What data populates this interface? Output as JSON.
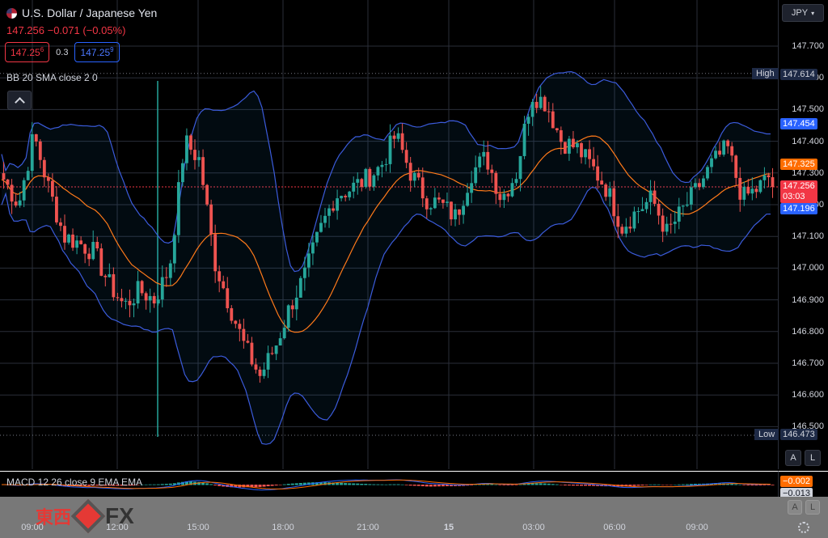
{
  "header": {
    "symbol_title": "U.S. Dollar / Japanese Yen",
    "price_line": "147.256 −0.071 (−0.05%)",
    "bid_main": "147.25",
    "bid_sup": "6",
    "spread": "0.3",
    "ask_main": "147.25",
    "ask_sup": "9",
    "indicator_label": "BB 20 SMA close 2 0",
    "collapse_icon": "chevron-up-icon"
  },
  "axis": {
    "currency": "JPY",
    "ticks": [
      "147.700",
      "147.600",
      "147.500",
      "147.400",
      "147.300",
      "147.200",
      "147.100",
      "147.000",
      "146.900",
      "146.800",
      "146.700",
      "146.600",
      "146.500"
    ],
    "high_label": "High",
    "high_value": "147.614",
    "low_label": "Low",
    "low_value": "146.473",
    "upper_band": "147.454",
    "basis": "147.325",
    "last_price": "147.256",
    "countdown": "03:03",
    "lower_band": "147.196",
    "scale_auto": "A",
    "scale_log": "L"
  },
  "macd": {
    "label": "MACD 12 26 close 9 EMA EMA",
    "value1": "−0.002",
    "value2": "−0.013",
    "scale_auto": "A",
    "scale_log": "L"
  },
  "time_axis": {
    "labels": [
      "09:00",
      "12:00",
      "15:00",
      "18:00",
      "21:00",
      "15",
      "03:00",
      "06:00",
      "09:00"
    ]
  },
  "watermark": {
    "cn": "東西",
    "fx": "FX"
  },
  "colors": {
    "up": "#26a69a",
    "down": "#ef5350",
    "band": "#3b5bdb",
    "basis": "#ff7a1a",
    "last": "#f23645"
  },
  "chart_data": {
    "type": "candlestick",
    "title": "U.S. Dollar / Japanese Yen",
    "ylim": [
      146.45,
      147.76
    ],
    "session_high": 147.614,
    "session_low": 146.473,
    "last": 147.256,
    "bollinger": {
      "period": 20,
      "upper_last": 147.454,
      "basis_last": 147.325,
      "lower_last": 147.196
    },
    "close_path": [
      147.28,
      147.2,
      147.42,
      147.25,
      147.1,
      147.08,
      147.05,
      146.95,
      146.88,
      146.93,
      146.9,
      147.0,
      147.4,
      147.34,
      147.02,
      146.88,
      146.75,
      146.66,
      146.75,
      146.88,
      146.98,
      147.12,
      147.23,
      147.25,
      147.28,
      147.32,
      147.42,
      147.3,
      147.22,
      147.2,
      147.16,
      147.3,
      147.35,
      147.22,
      147.3,
      147.55,
      147.52,
      147.4,
      147.38,
      147.32,
      147.25,
      147.13,
      147.18,
      147.22,
      147.11,
      147.18,
      147.25,
      147.33,
      147.38,
      147.22,
      147.25,
      147.3
    ]
  }
}
